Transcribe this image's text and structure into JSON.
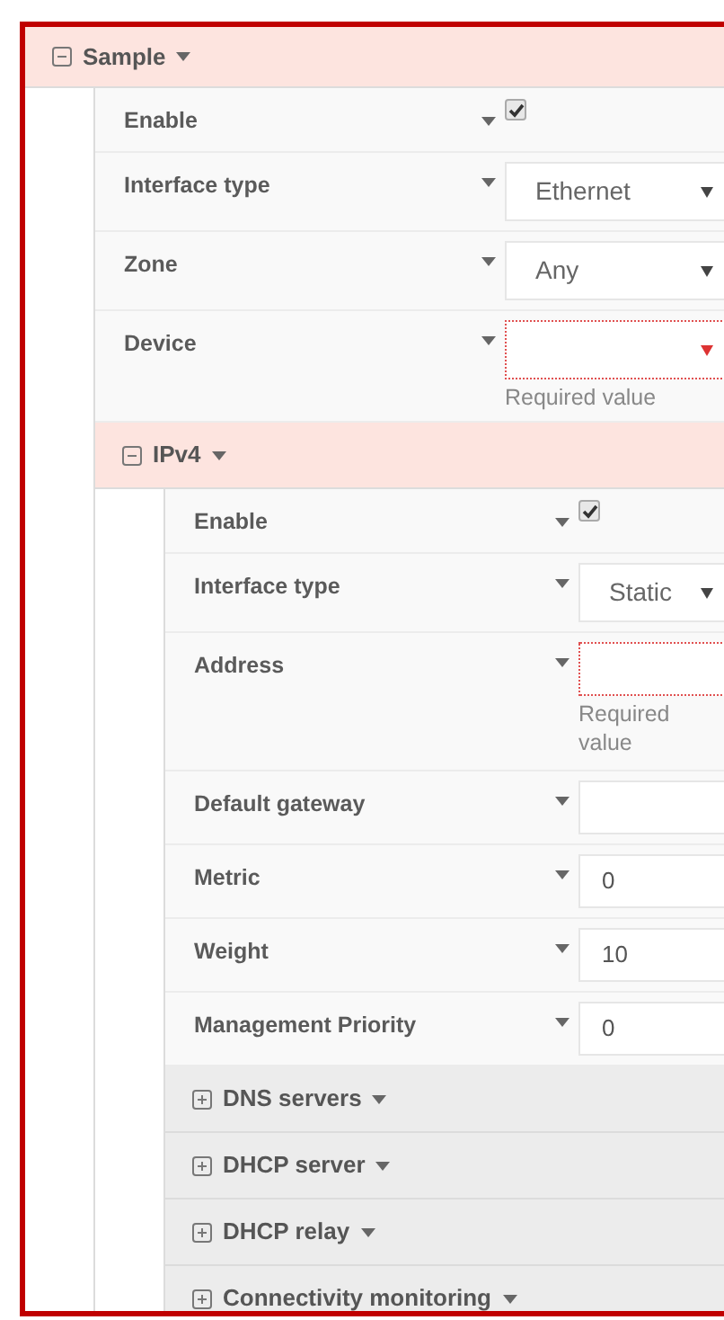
{
  "section": {
    "title": "Sample",
    "expanded": true,
    "items": [
      {
        "kind": "checkbox",
        "label": "Enable",
        "checked": true
      },
      {
        "kind": "select",
        "label": "Interface type",
        "value": "Ethernet"
      },
      {
        "kind": "select",
        "label": "Zone",
        "value": "Any"
      },
      {
        "kind": "select",
        "label": "Device",
        "required": true,
        "error": "Required value"
      },
      {
        "kind": "section",
        "title": "IPv4",
        "expanded": true,
        "items": [
          {
            "kind": "checkbox",
            "label": "Enable",
            "checked": true
          },
          {
            "kind": "select",
            "label": "Interface type",
            "value": "Static"
          },
          {
            "kind": "text",
            "label": "Address",
            "required": true,
            "error": "Required value"
          },
          {
            "kind": "text",
            "label": "Default gateway"
          },
          {
            "kind": "text",
            "label": "Metric",
            "value": "0"
          },
          {
            "kind": "text",
            "label": "Weight",
            "value": "10"
          },
          {
            "kind": "text",
            "label": "Management Priority",
            "value": "0"
          },
          {
            "kind": "section",
            "title": "DNS servers",
            "expanded": false
          },
          {
            "kind": "section",
            "title": "DHCP server",
            "expanded": false
          },
          {
            "kind": "section",
            "title": "DHCP relay",
            "expanded": false
          },
          {
            "kind": "section",
            "title": "Connectivity monitoring",
            "expanded": false
          }
        ]
      }
    ]
  }
}
